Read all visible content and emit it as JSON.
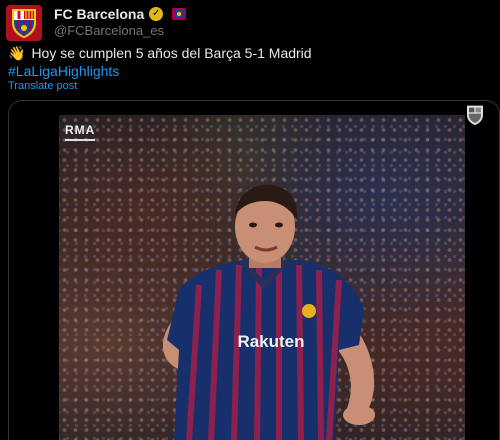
{
  "header": {
    "display_name": "FC Barcelona",
    "handle": "@FCBarcelona_es"
  },
  "post": {
    "text_line1": "Hoy se cumplen 5 años del Barça 5-1 Madrid",
    "emoji": "👋",
    "hashtag": "#LaLigaHighlights",
    "translate_label": "Translate post"
  },
  "media": {
    "score_tag": "RMA"
  },
  "colors": {
    "background": "#000000",
    "text": "#e7e9ea",
    "secondary_text": "#71767b",
    "link": "#1d9bf0",
    "verified_badge": "#e2b719",
    "barca_blue": "#004d98",
    "barca_garnet": "#a50044"
  },
  "icons": {
    "avatar": "fc-barcelona-crest",
    "verified": "gold-verified-badge",
    "affiliation": "fc-barcelona-affiliate-badge",
    "video_watermark": "fc-barcelona-crest"
  }
}
